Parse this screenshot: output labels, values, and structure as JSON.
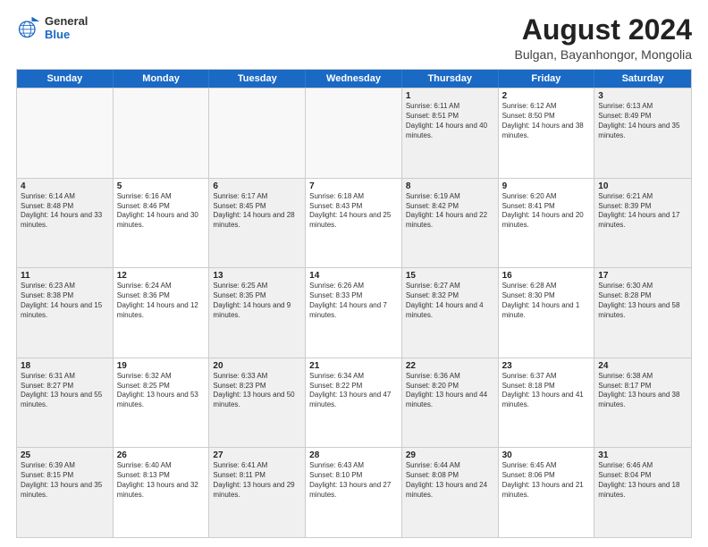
{
  "logo": {
    "general": "General",
    "blue": "Blue"
  },
  "title": "August 2024",
  "subtitle": "Bulgan, Bayanhongor, Mongolia",
  "days": [
    "Sunday",
    "Monday",
    "Tuesday",
    "Wednesday",
    "Thursday",
    "Friday",
    "Saturday"
  ],
  "weeks": [
    [
      {
        "day": "",
        "text": ""
      },
      {
        "day": "",
        "text": ""
      },
      {
        "day": "",
        "text": ""
      },
      {
        "day": "",
        "text": ""
      },
      {
        "day": "1",
        "text": "Sunrise: 6:11 AM\nSunset: 8:51 PM\nDaylight: 14 hours and 40 minutes."
      },
      {
        "day": "2",
        "text": "Sunrise: 6:12 AM\nSunset: 8:50 PM\nDaylight: 14 hours and 38 minutes."
      },
      {
        "day": "3",
        "text": "Sunrise: 6:13 AM\nSunset: 8:49 PM\nDaylight: 14 hours and 35 minutes."
      }
    ],
    [
      {
        "day": "4",
        "text": "Sunrise: 6:14 AM\nSunset: 8:48 PM\nDaylight: 14 hours and 33 minutes."
      },
      {
        "day": "5",
        "text": "Sunrise: 6:16 AM\nSunset: 8:46 PM\nDaylight: 14 hours and 30 minutes."
      },
      {
        "day": "6",
        "text": "Sunrise: 6:17 AM\nSunset: 8:45 PM\nDaylight: 14 hours and 28 minutes."
      },
      {
        "day": "7",
        "text": "Sunrise: 6:18 AM\nSunset: 8:43 PM\nDaylight: 14 hours and 25 minutes."
      },
      {
        "day": "8",
        "text": "Sunrise: 6:19 AM\nSunset: 8:42 PM\nDaylight: 14 hours and 22 minutes."
      },
      {
        "day": "9",
        "text": "Sunrise: 6:20 AM\nSunset: 8:41 PM\nDaylight: 14 hours and 20 minutes."
      },
      {
        "day": "10",
        "text": "Sunrise: 6:21 AM\nSunset: 8:39 PM\nDaylight: 14 hours and 17 minutes."
      }
    ],
    [
      {
        "day": "11",
        "text": "Sunrise: 6:23 AM\nSunset: 8:38 PM\nDaylight: 14 hours and 15 minutes."
      },
      {
        "day": "12",
        "text": "Sunrise: 6:24 AM\nSunset: 8:36 PM\nDaylight: 14 hours and 12 minutes."
      },
      {
        "day": "13",
        "text": "Sunrise: 6:25 AM\nSunset: 8:35 PM\nDaylight: 14 hours and 9 minutes."
      },
      {
        "day": "14",
        "text": "Sunrise: 6:26 AM\nSunset: 8:33 PM\nDaylight: 14 hours and 7 minutes."
      },
      {
        "day": "15",
        "text": "Sunrise: 6:27 AM\nSunset: 8:32 PM\nDaylight: 14 hours and 4 minutes."
      },
      {
        "day": "16",
        "text": "Sunrise: 6:28 AM\nSunset: 8:30 PM\nDaylight: 14 hours and 1 minute."
      },
      {
        "day": "17",
        "text": "Sunrise: 6:30 AM\nSunset: 8:28 PM\nDaylight: 13 hours and 58 minutes."
      }
    ],
    [
      {
        "day": "18",
        "text": "Sunrise: 6:31 AM\nSunset: 8:27 PM\nDaylight: 13 hours and 55 minutes."
      },
      {
        "day": "19",
        "text": "Sunrise: 6:32 AM\nSunset: 8:25 PM\nDaylight: 13 hours and 53 minutes."
      },
      {
        "day": "20",
        "text": "Sunrise: 6:33 AM\nSunset: 8:23 PM\nDaylight: 13 hours and 50 minutes."
      },
      {
        "day": "21",
        "text": "Sunrise: 6:34 AM\nSunset: 8:22 PM\nDaylight: 13 hours and 47 minutes."
      },
      {
        "day": "22",
        "text": "Sunrise: 6:36 AM\nSunset: 8:20 PM\nDaylight: 13 hours and 44 minutes."
      },
      {
        "day": "23",
        "text": "Sunrise: 6:37 AM\nSunset: 8:18 PM\nDaylight: 13 hours and 41 minutes."
      },
      {
        "day": "24",
        "text": "Sunrise: 6:38 AM\nSunset: 8:17 PM\nDaylight: 13 hours and 38 minutes."
      }
    ],
    [
      {
        "day": "25",
        "text": "Sunrise: 6:39 AM\nSunset: 8:15 PM\nDaylight: 13 hours and 35 minutes."
      },
      {
        "day": "26",
        "text": "Sunrise: 6:40 AM\nSunset: 8:13 PM\nDaylight: 13 hours and 32 minutes."
      },
      {
        "day": "27",
        "text": "Sunrise: 6:41 AM\nSunset: 8:11 PM\nDaylight: 13 hours and 29 minutes."
      },
      {
        "day": "28",
        "text": "Sunrise: 6:43 AM\nSunset: 8:10 PM\nDaylight: 13 hours and 27 minutes."
      },
      {
        "day": "29",
        "text": "Sunrise: 6:44 AM\nSunset: 8:08 PM\nDaylight: 13 hours and 24 minutes."
      },
      {
        "day": "30",
        "text": "Sunrise: 6:45 AM\nSunset: 8:06 PM\nDaylight: 13 hours and 21 minutes."
      },
      {
        "day": "31",
        "text": "Sunrise: 6:46 AM\nSunset: 8:04 PM\nDaylight: 13 hours and 18 minutes."
      }
    ]
  ]
}
